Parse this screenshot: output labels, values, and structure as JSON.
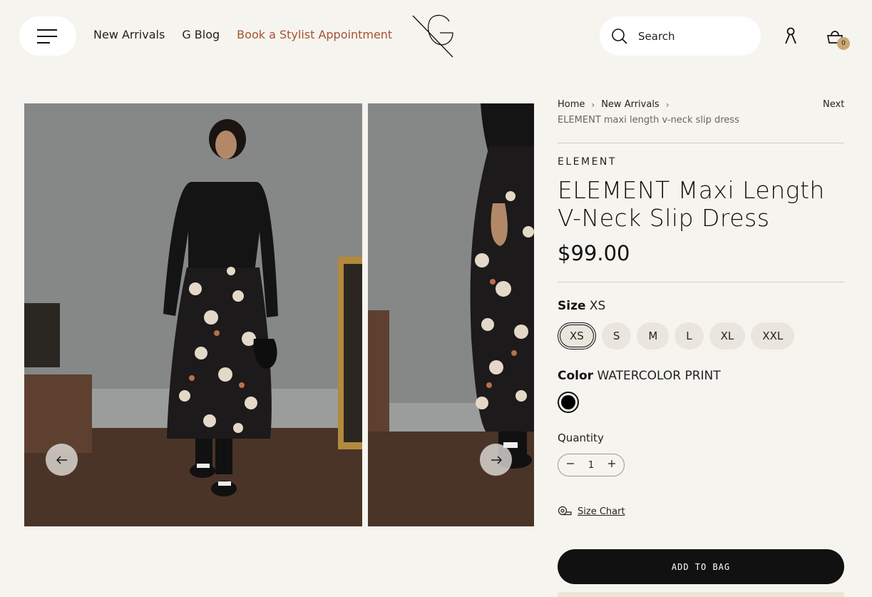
{
  "header": {
    "menu_icon": "hamburger-menu-icon",
    "nav": [
      {
        "label": "New Arrivals"
      },
      {
        "label": "G Blog"
      },
      {
        "label": "Book a Stylist Appointment",
        "color": "#a55232"
      }
    ],
    "logo_icon": "brand-logo-icon",
    "search": {
      "placeholder": "Search",
      "icon": "search-icon"
    },
    "account_icon": "user-icon",
    "cart": {
      "icon": "shopping-bag-icon",
      "count": "0"
    }
  },
  "gallery": {
    "prev_icon": "arrow-left-icon",
    "next_icon": "arrow-right-icon"
  },
  "product": {
    "breadcrumb": {
      "home": "Home",
      "parent": "New Arrivals",
      "current": "ELEMENT maxi length v-neck slip dress",
      "next": "Next"
    },
    "brand": "ELEMENT",
    "title": "ELEMENT Maxi Length V-Neck Slip Dress",
    "price": "$99.00",
    "size": {
      "label": "Size",
      "selected": "XS",
      "options": [
        "XS",
        "S",
        "M",
        "L",
        "XL",
        "XXL"
      ]
    },
    "color": {
      "label": "Color",
      "selected": "WATERCOLOR PRINT",
      "swatch_color": "#000000"
    },
    "quantity": {
      "label": "Quantity",
      "value": "1",
      "minus_icon": "minus-icon",
      "plus_icon": "plus-icon"
    },
    "size_chart": {
      "label": "Size Chart",
      "icon": "measuring-tape-icon"
    },
    "add_to_bag": "ADD TO BAG"
  },
  "colors": {
    "background": "#f6f4ef",
    "accent": "#a55232",
    "badge": "#c9a877",
    "button": "#111111"
  }
}
